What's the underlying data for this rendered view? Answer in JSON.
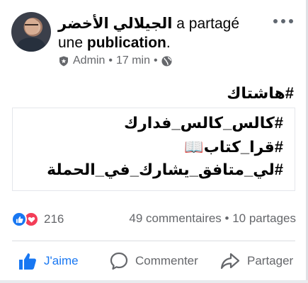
{
  "post": {
    "author_name": "الجيلالي الأخضر",
    "action_text": " a partagé une ",
    "action_object": "publication",
    "action_suffix": ".",
    "role": "Admin",
    "time": "17 min",
    "separator": "•",
    "audience_icon": "globe-icon",
    "hashtag_title": "#هاشتاك",
    "lines": [
      "#كالس_كالس_فدارك",
      "#قرا_كتاب📖",
      "#لي_متافق_يشارك_في_الحملة"
    ]
  },
  "engagement": {
    "reaction_icons": [
      "like-icon",
      "love-icon"
    ],
    "reaction_count": "216",
    "comments_shares": "49 commentaires • 10 partages"
  },
  "actions": {
    "like_label": "J'aime",
    "comment_label": "Commenter",
    "share_label": "Partager"
  },
  "colors": {
    "accent": "#1877f2",
    "love": "#f33e58",
    "secondary_text": "#65676b"
  }
}
